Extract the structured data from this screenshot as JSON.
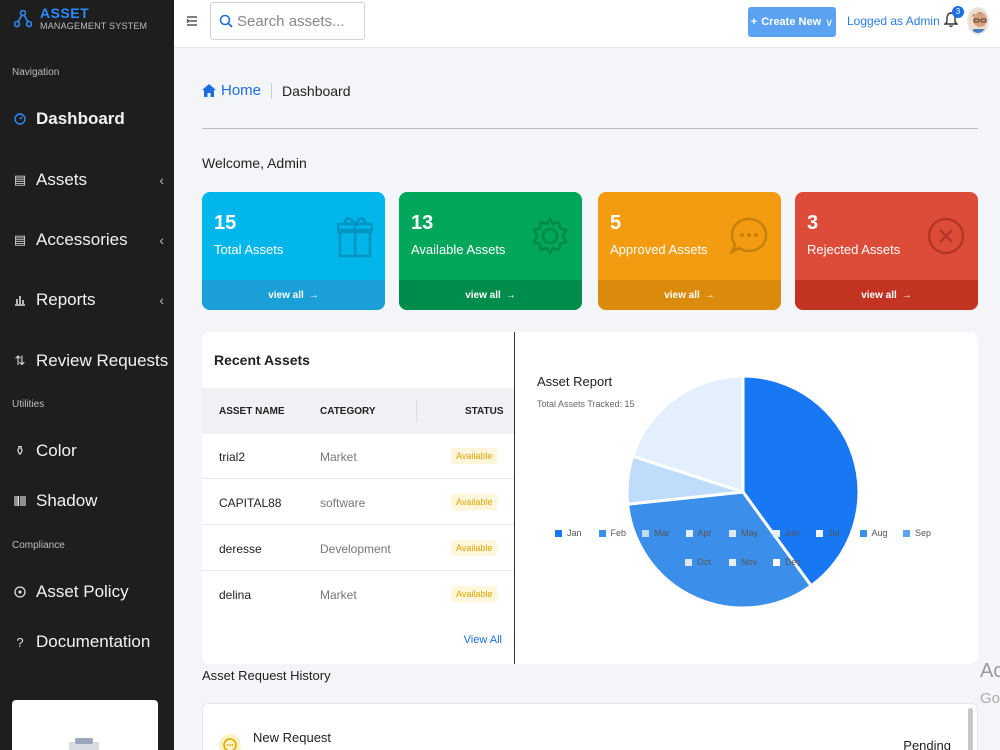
{
  "brand": {
    "title": "ASSET",
    "subtitle": "MANAGEMENT SYSTEM"
  },
  "sidebar": {
    "sections": [
      "Navigation",
      "Utilities",
      "Compliance"
    ],
    "items": [
      {
        "label": "Dashboard",
        "icon": "gauge-icon"
      },
      {
        "label": "Assets",
        "icon": "list-icon"
      },
      {
        "label": "Accessories",
        "icon": "list-icon"
      },
      {
        "label": "Reports",
        "icon": "bar-chart-icon"
      },
      {
        "label": "Review Requests",
        "icon": "sort-icon"
      },
      {
        "label": "Color",
        "icon": "paint-icon"
      },
      {
        "label": "Shadow",
        "icon": "barcode-icon"
      },
      {
        "label": "Asset Policy",
        "icon": "shield-icon"
      },
      {
        "label": "Documentation",
        "icon": "question-icon"
      }
    ]
  },
  "topbar": {
    "search_placeholder": "Search assets...",
    "create_label": "Create New",
    "logged_label": "Logged as Admin",
    "notif_count": "3"
  },
  "breadcrumb": {
    "home": "Home",
    "current": "Dashboard"
  },
  "welcome": "Welcome, Admin",
  "stats": [
    {
      "value": "15",
      "label": "Total Assets",
      "color": "#00b6ea",
      "foot": "#1a9fd8",
      "link": "view all"
    },
    {
      "value": "13",
      "label": "Available Assets",
      "color": "#00a65a",
      "foot": "#008d4c",
      "link": "view all"
    },
    {
      "value": "5",
      "label": "Approved Assets",
      "color": "#f39c12",
      "foot": "#db8b0b",
      "link": "view all"
    },
    {
      "value": "3",
      "label": "Rejected Assets",
      "color": "#dd4b39",
      "foot": "#c23321",
      "link": "view all"
    }
  ],
  "recent": {
    "title": "Recent Assets",
    "columns": [
      "ASSET NAME",
      "CATEGORY",
      "STATUS"
    ],
    "rows": [
      {
        "name": "trial2",
        "category": "Market",
        "status": "Available"
      },
      {
        "name": "CAPITAL88",
        "category": "software",
        "status": "Available"
      },
      {
        "name": "deresse",
        "category": "Development",
        "status": "Available"
      },
      {
        "name": "delina",
        "category": "Market",
        "status": "Available"
      }
    ],
    "view_all": "View All"
  },
  "chart_data": {
    "type": "pie",
    "title": "Asset Report",
    "subtitle": "Total Assets Tracked: 15",
    "categories": [
      "Jan",
      "Feb",
      "Mar",
      "Apr",
      "May",
      "Jun",
      "Jul",
      "Aug",
      "Sep",
      "Oct",
      "Nov",
      "Dec"
    ],
    "values": [
      6,
      5,
      1,
      3,
      0,
      0,
      0,
      0,
      0,
      0,
      0,
      0
    ],
    "colors": [
      "#1877f2",
      "#3b8eea",
      "#bfdcfb",
      "#e3effc",
      "#dfe9f5",
      "#e8edf3",
      "#f3f3f3",
      "#3b8eea",
      "#5ba3f2",
      "#dfe9f5",
      "#e8edf3",
      "#ffffff"
    ]
  },
  "request_history": {
    "title": "Asset Request History",
    "items": [
      {
        "name": "New Request",
        "status": "Pending"
      }
    ]
  },
  "watermark": {
    "line1": "Ac",
    "line2": "Go"
  }
}
